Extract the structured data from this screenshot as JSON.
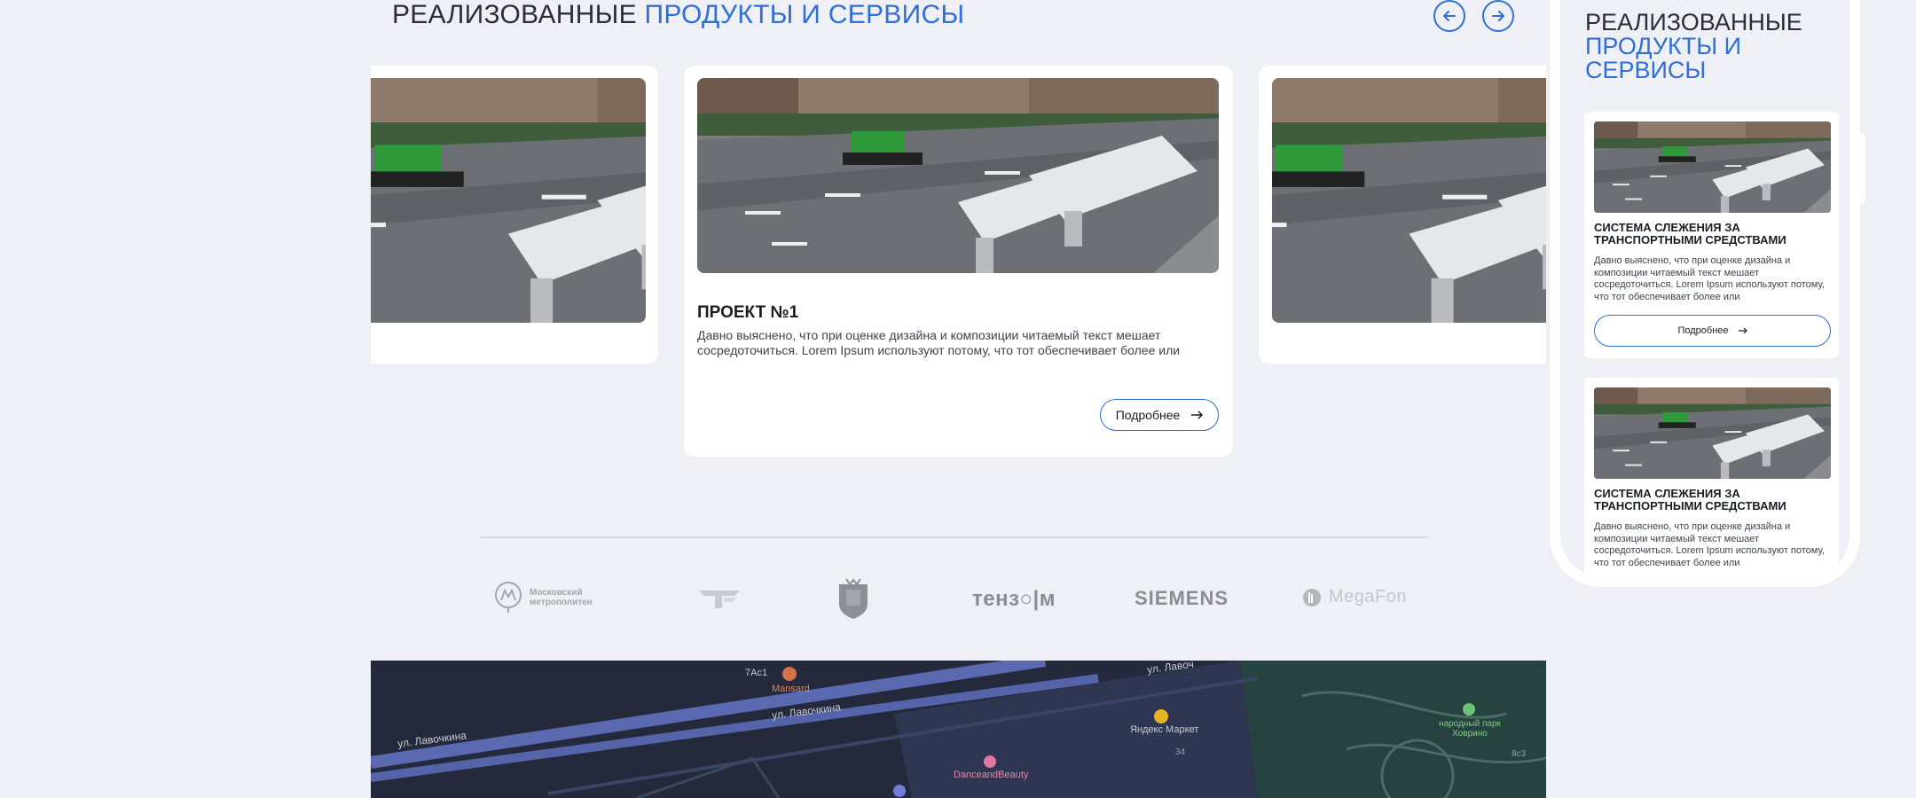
{
  "section": {
    "title_plain": "РЕАЛИЗОВАННЫЕ",
    "title_accent": "ПРОДУКТЫ И СЕРВИСЫ",
    "prev_icon": "arrow-left-icon",
    "next_icon": "arrow-right-icon",
    "accent_color": "#2f6fd6"
  },
  "slider": {
    "active_card": {
      "title": "ПРОЕКТ №1",
      "text": "Давно выяснено, что при оценке дизайна и композиции читаемый текст мешает сосредоточиться. Lorem Ipsum используют потому, что тот обеспечивает более или",
      "button_label": "Подробнее"
    }
  },
  "partners": [
    {
      "name": "Московский метрополитен",
      "line1": "Московский",
      "line2": "метрополитен"
    },
    {
      "name": "logo-2"
    },
    {
      "name": "coat-of-arms"
    },
    {
      "name": "ТЕНЗОР",
      "text": "тенз○|м"
    },
    {
      "name": "SIEMENS",
      "text": "SIEMENS"
    },
    {
      "name": "MegaFon",
      "text": "MegaFon"
    }
  ],
  "map": {
    "labels": {
      "street1": "ул. Лавочкина",
      "street2": "ул. Лавочкина",
      "street3": "ул. Лавоч",
      "building1": "7Ac1",
      "place1": "Mansard",
      "place2": "Яндекс Маркет",
      "place3": "DanceandBeauty",
      "number1": "34",
      "park": "народный парк Ховрино",
      "building2": "8c3"
    }
  },
  "mobile": {
    "title_plain": "РЕАЛИЗОВАННЫЕ",
    "title_accent": "ПРОДУКТЫ И СЕРВИСЫ",
    "cards": [
      {
        "title": "СИСТЕМА СЛЕЖЕНИЯ ЗА ТРАНСПОРТНЫМИ СРЕДСТВАМИ",
        "text": "Давно выяснено, что при оценке дизайна и композиции читаемый текст мешает сосредоточиться. Lorem Ipsum используют потому, что тот обеспечивает более или",
        "button_label": "Подробнее"
      },
      {
        "title": "СИСТЕМА СЛЕЖЕНИЯ ЗА ТРАНСПОРТНЫМИ СРЕДСТВАМИ",
        "text": "Давно выяснено, что при оценке дизайна и композиции читаемый текст мешает сосредоточиться. Lorem Ipsum используют потому, что тот обеспечивает более или"
      }
    ]
  }
}
